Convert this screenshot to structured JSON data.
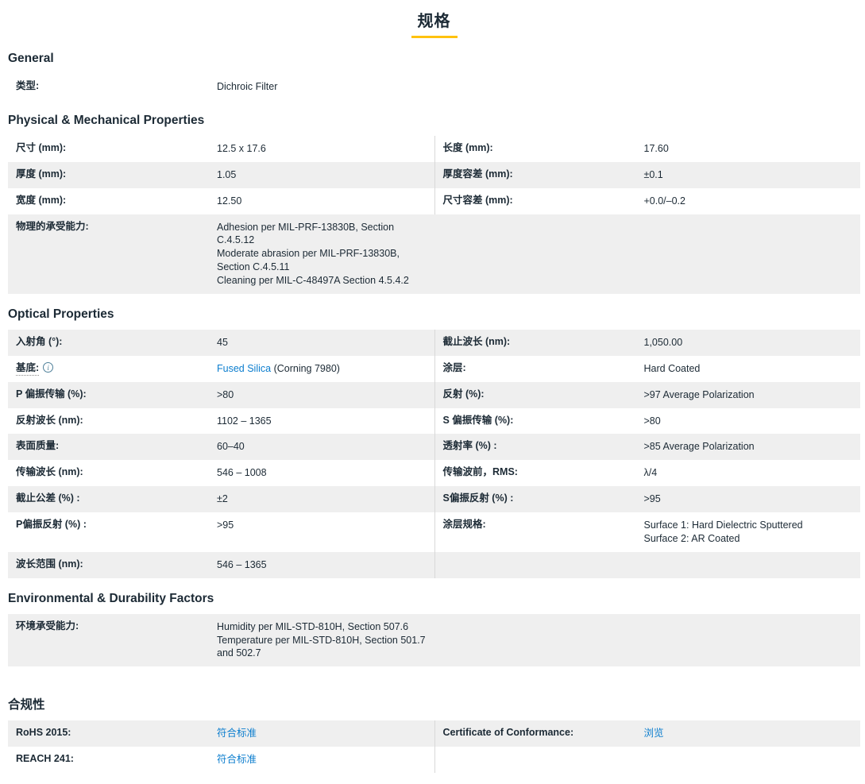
{
  "title": "规格",
  "colors": {
    "accent_yellow": "#ffc20e",
    "link_blue": "#0b7dce",
    "text_dark": "#1c2a35",
    "row_stripe": "#efefef"
  },
  "icons": {
    "info": "i"
  },
  "sections": [
    {
      "heading": "General",
      "rows": [
        {
          "shaded": false,
          "divider": false,
          "left": {
            "label": "类型:",
            "value": "Dichroic Filter"
          },
          "right": null
        }
      ]
    },
    {
      "heading": "Physical & Mechanical Properties",
      "rows": [
        {
          "shaded": false,
          "divider": true,
          "left": {
            "label": "尺寸 (mm):",
            "value": "12.5 x 17.6"
          },
          "right": {
            "label": "长度 (mm):",
            "value": "17.60"
          }
        },
        {
          "shaded": true,
          "divider": true,
          "left": {
            "label": "厚度 (mm):",
            "value": "1.05"
          },
          "right": {
            "label": "厚度容差 (mm):",
            "value": "±0.1"
          }
        },
        {
          "shaded": false,
          "divider": true,
          "left": {
            "label": "宽度 (mm):",
            "value": "12.50"
          },
          "right": {
            "label": "尺寸容差 (mm):",
            "value": "+0.0/–0.2"
          }
        },
        {
          "shaded": true,
          "divider": false,
          "left": {
            "label": "物理的承受能力:",
            "value_lines": [
              "Adhesion per MIL-PRF-13830B, Section C.4.5.12",
              "Moderate abrasion per MIL-PRF-13830B, Section C.4.5.11",
              "Cleaning per MIL-C-48497A Section 4.5.4.2"
            ]
          },
          "right": null
        }
      ]
    },
    {
      "heading": "Optical Properties",
      "rows": [
        {
          "shaded": true,
          "divider": true,
          "left": {
            "label": "入射角 (°):",
            "value": "45"
          },
          "right": {
            "label": "截止波长 (nm):",
            "value": "1,050.00"
          }
        },
        {
          "shaded": false,
          "divider": true,
          "left": {
            "label": "基底:",
            "dotted": true,
            "info": true,
            "value_parts": [
              {
                "text": "Fused Silica",
                "link": true
              },
              {
                "text": " (Corning 7980)",
                "link": false
              }
            ]
          },
          "right": {
            "label": "涂层:",
            "value": "Hard Coated"
          }
        },
        {
          "shaded": true,
          "divider": true,
          "left": {
            "label": "P 偏振传输 (%):",
            "value": ">80"
          },
          "right": {
            "label": "反射 (%):",
            "value": ">97 Average Polarization"
          }
        },
        {
          "shaded": false,
          "divider": true,
          "left": {
            "label": "反射波长 (nm):",
            "value": "1102 – 1365"
          },
          "right": {
            "label": "S 偏振传输 (%):",
            "value": ">80"
          }
        },
        {
          "shaded": true,
          "divider": true,
          "left": {
            "label": "表面质量:",
            "value": "60–40"
          },
          "right": {
            "label": "透射率 (%) :",
            "value": ">85 Average Polarization"
          }
        },
        {
          "shaded": false,
          "divider": true,
          "left": {
            "label": "传输波长 (nm):",
            "value": "546 – 1008"
          },
          "right": {
            "label": "传输波前，RMS:",
            "value": "λ/4"
          }
        },
        {
          "shaded": true,
          "divider": true,
          "left": {
            "label": "截止公差 (%) :",
            "value": "±2"
          },
          "right": {
            "label": "S偏振反射 (%) :",
            "value": ">95"
          }
        },
        {
          "shaded": false,
          "divider": true,
          "left": {
            "label": "P偏振反射 (%) :",
            "value": ">95"
          },
          "right": {
            "label": "涂层规格:",
            "value_lines": [
              "Surface 1: Hard Dielectric Sputtered",
              "Surface 2: AR Coated"
            ]
          }
        },
        {
          "shaded": true,
          "divider": true,
          "left": {
            "label": "波长范围 (nm):",
            "value": "546 – 1365"
          },
          "right": null
        }
      ]
    },
    {
      "heading": "Environmental & Durability Factors",
      "rows": [
        {
          "shaded": true,
          "divider": false,
          "left": {
            "label": "环境承受能力:",
            "value_lines": [
              "Humidity per MIL-STD-810H, Section 507.6",
              "Temperature per MIL-STD-810H, Section 501.7 and 502.7"
            ]
          },
          "right": null
        }
      ]
    },
    {
      "heading": "合规性",
      "extra_gap": true,
      "rows": [
        {
          "shaded": true,
          "divider": true,
          "left": {
            "label": "RoHS 2015:",
            "value_parts": [
              {
                "text": "符合标准",
                "link": true
              }
            ]
          },
          "right": {
            "label": "Certificate of Conformance:",
            "value_parts": [
              {
                "text": "浏览",
                "link": true
              }
            ]
          }
        },
        {
          "shaded": false,
          "divider": true,
          "left": {
            "label": "REACH 241:",
            "value_parts": [
              {
                "text": "符合标准",
                "link": true
              }
            ]
          },
          "right": null
        }
      ]
    }
  ]
}
